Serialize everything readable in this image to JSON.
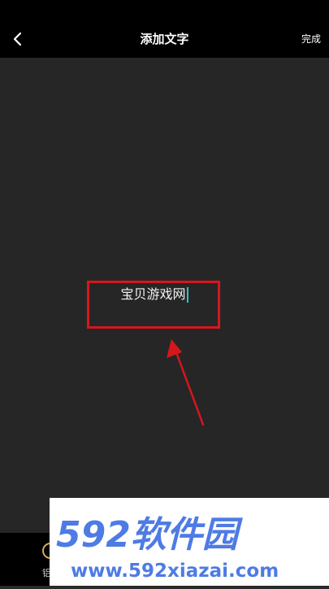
{
  "header": {
    "title": "添加文字",
    "done_label": "完成",
    "back_icon": "chevron-left-icon"
  },
  "editor": {
    "text_value": "宝贝游戏网",
    "highlight_color": "#d7161c",
    "caret_color": "#2bc3c9"
  },
  "toolbar": {
    "partial_label": "铝"
  },
  "watermark": {
    "brand": "592软件园",
    "url": "www.592xiazai.com",
    "color": "#4e7be4"
  }
}
